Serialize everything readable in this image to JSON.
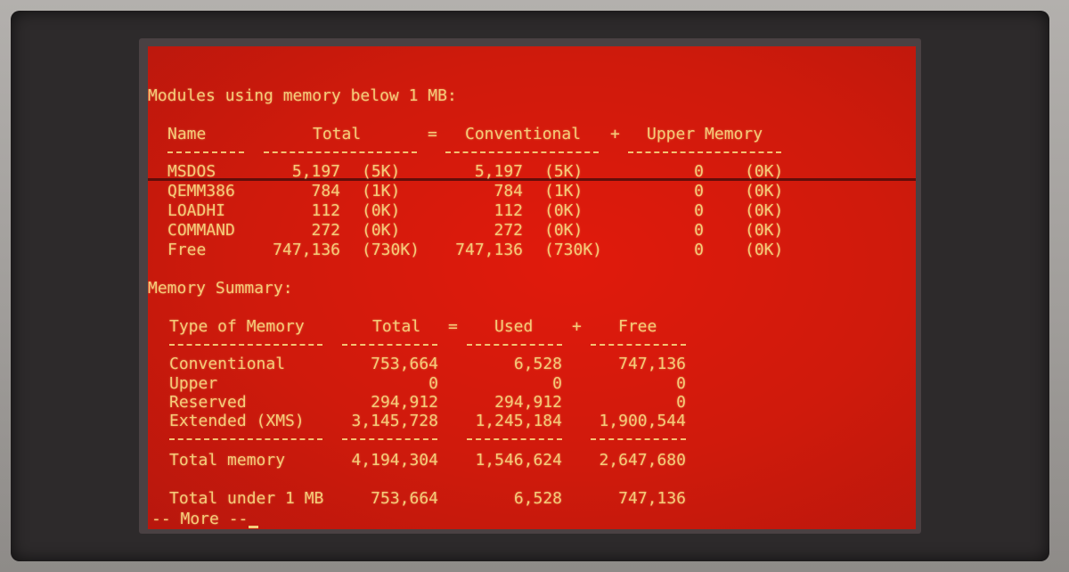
{
  "modules": {
    "heading": "Modules using memory below 1 MB:",
    "headers": {
      "name": "Name",
      "total": "Total",
      "eq": "=",
      "conventional": "Conventional",
      "plus": "+",
      "upper": "Upper Memory"
    },
    "rows": [
      {
        "name": "MSDOS",
        "total": "5,197",
        "total_k": "(5K)",
        "conv": "5,197",
        "conv_k": "(5K)",
        "upper": "0",
        "upper_k": "(0K)"
      },
      {
        "name": "QEMM386",
        "total": "784",
        "total_k": "(1K)",
        "conv": "784",
        "conv_k": "(1K)",
        "upper": "0",
        "upper_k": "(0K)"
      },
      {
        "name": "LOADHI",
        "total": "112",
        "total_k": "(0K)",
        "conv": "112",
        "conv_k": "(0K)",
        "upper": "0",
        "upper_k": "(0K)"
      },
      {
        "name": "COMMAND",
        "total": "272",
        "total_k": "(0K)",
        "conv": "272",
        "conv_k": "(0K)",
        "upper": "0",
        "upper_k": "(0K)"
      },
      {
        "name": "Free",
        "total": "747,136",
        "total_k": "(730K)",
        "conv": "747,136",
        "conv_k": "(730K)",
        "upper": "0",
        "upper_k": "(0K)"
      }
    ]
  },
  "summary": {
    "heading": "Memory Summary:",
    "headers": {
      "type": "Type of Memory",
      "total": "Total",
      "eq": "=",
      "used": "Used",
      "plus": "+",
      "free": "Free"
    },
    "rows": [
      {
        "type": "Conventional",
        "total": "753,664",
        "used": "6,528",
        "free": "747,136"
      },
      {
        "type": "Upper",
        "total": "0",
        "used": "0",
        "free": "0"
      },
      {
        "type": "Reserved",
        "total": "294,912",
        "used": "294,912",
        "free": "0"
      },
      {
        "type": "Extended (XMS)",
        "total": "3,145,728",
        "used": "1,245,184",
        "free": "1,900,544"
      }
    ],
    "total_memory": {
      "type": "Total memory",
      "total": "4,194,304",
      "used": "1,546,624",
      "free": "2,647,680"
    },
    "total_under": {
      "type": "Total under 1 MB",
      "total": "753,664",
      "used": "6,528",
      "free": "747,136"
    }
  },
  "prompt": "-- More --",
  "colors": {
    "screen": "#d81a0c",
    "phosphor": "#f5cc79",
    "bezel": "#2d2a2b"
  }
}
